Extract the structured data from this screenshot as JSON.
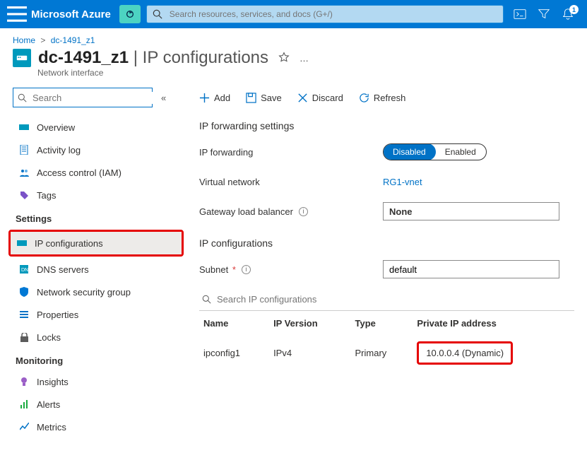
{
  "header": {
    "brand": "Microsoft Azure",
    "search_placeholder": "Search resources, services, and docs (G+/)",
    "notification_count": "1"
  },
  "breadcrumb": {
    "home": "Home",
    "current": "dc-1491_z1"
  },
  "page": {
    "resource_name": "dc-1491_z1",
    "page_name": "IP configurations",
    "subtitle": "Network interface"
  },
  "sidebar": {
    "search_placeholder": "Search",
    "overview": "Overview",
    "activity": "Activity log",
    "iam": "Access control (IAM)",
    "tags": "Tags",
    "sect_settings": "Settings",
    "ipconfig": "IP configurations",
    "dns": "DNS servers",
    "nsg": "Network security group",
    "properties": "Properties",
    "locks": "Locks",
    "sect_monitoring": "Monitoring",
    "insights": "Insights",
    "alerts": "Alerts",
    "metrics": "Metrics"
  },
  "toolbar": {
    "add": "Add",
    "save": "Save",
    "discard": "Discard",
    "refresh": "Refresh"
  },
  "forwarding": {
    "heading": "IP forwarding settings",
    "label_fwd": "IP forwarding",
    "disabled": "Disabled",
    "enabled": "Enabled",
    "label_vnet": "Virtual network",
    "vnet_value": "RG1-vnet",
    "label_glb": "Gateway load balancer",
    "glb_value": "None"
  },
  "ipcfg": {
    "heading": "IP configurations",
    "label_subnet": "Subnet",
    "subnet_value": "default",
    "filter_placeholder": "Search IP configurations",
    "col_name": "Name",
    "col_ipver": "IP Version",
    "col_type": "Type",
    "col_priv": "Private IP address",
    "row_name": "ipconfig1",
    "row_ipver": "IPv4",
    "row_type": "Primary",
    "row_priv": "10.0.0.4 (Dynamic)"
  }
}
